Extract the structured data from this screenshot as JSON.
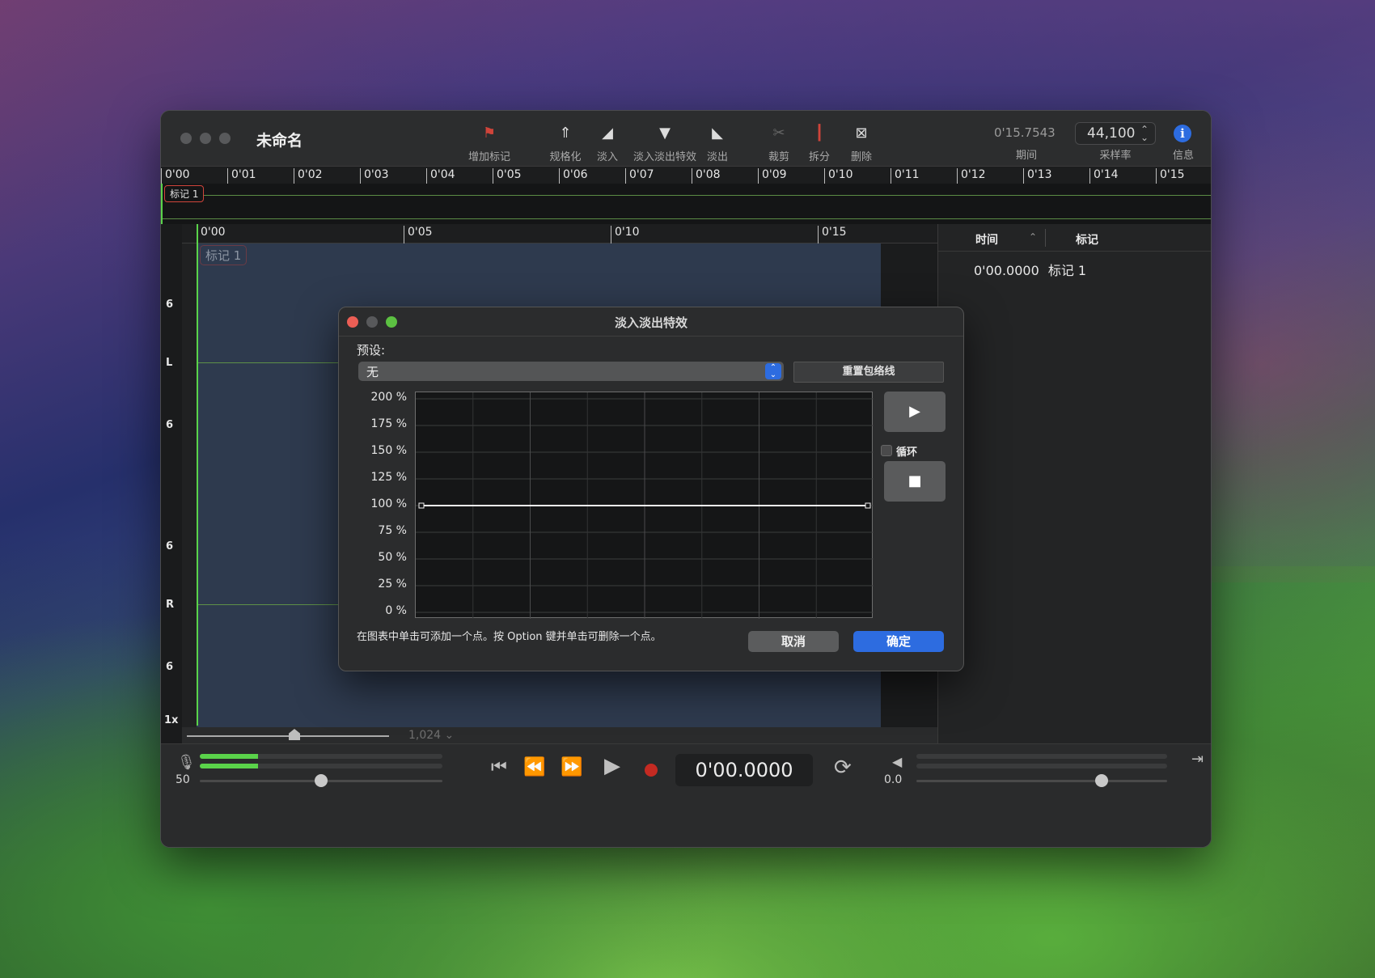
{
  "window": {
    "title": "未命名",
    "toolbar": [
      {
        "label": "增加标记",
        "icon": "add-marker-icon"
      },
      {
        "label": "规格化",
        "icon": "normalize-icon"
      },
      {
        "label": "淡入",
        "icon": "fade-in-icon"
      },
      {
        "label": "淡入淡出特效",
        "icon": "fade-effect-icon"
      },
      {
        "label": "淡出",
        "icon": "fade-out-icon"
      },
      {
        "label": "裁剪",
        "icon": "trim-icon"
      },
      {
        "label": "拆分",
        "icon": "split-icon"
      },
      {
        "label": "删除",
        "icon": "delete-icon"
      }
    ],
    "duration": {
      "value": "0'15.7543",
      "label": "期间"
    },
    "sample_rate": {
      "value": "44,100",
      "label": "采样率"
    },
    "info": {
      "label": "信息"
    }
  },
  "top_ruler": [
    "0'00",
    "0'01",
    "0'02",
    "0'03",
    "0'04",
    "0'05",
    "0'06",
    "0'07",
    "0'08",
    "0'09",
    "0'10",
    "0'11",
    "0'12",
    "0'13",
    "0'14",
    "0'15"
  ],
  "overview": {
    "marker": "标记 1"
  },
  "waveform": {
    "ruler": [
      "0'00",
      "0'05",
      "0'10",
      "0'15"
    ],
    "marker": "标记 1",
    "scale_labels": [
      "6",
      "L",
      "6",
      "6",
      "R",
      "6"
    ],
    "zoom_label": "1x",
    "zoom_value": "1,024"
  },
  "markers_panel": {
    "col_time": "时间",
    "col_marker": "标记",
    "rows": [
      {
        "time": "0'00.0000",
        "name": "标记 1"
      }
    ]
  },
  "transport": {
    "input_level": "50",
    "time": "0'00.0000",
    "output_level": "0.0",
    "input_meter": 0.24,
    "input_slider": 0.5,
    "output_slider": 0.74
  },
  "dialog": {
    "title": "淡入淡出特效",
    "preset_label": "预设:",
    "preset_value": "无",
    "reset_button": "重置包络线",
    "y_axis": [
      "200 %",
      "175 %",
      "150 %",
      "125 %",
      "100 %",
      "75 %",
      "50 %",
      "25 %",
      "0 %"
    ],
    "loop_label": "循环",
    "hint": "在图表中单击可添加一个点。按 Option 键并单击可删除一个点。",
    "cancel": "取消",
    "ok": "确定",
    "envelope": {
      "start_percent": 100,
      "end_percent": 100
    }
  },
  "colors": {
    "accent": "#2d6ce0",
    "playhead": "#5ad34a",
    "record": "#c42a22",
    "marker_border": "#d0443a"
  }
}
